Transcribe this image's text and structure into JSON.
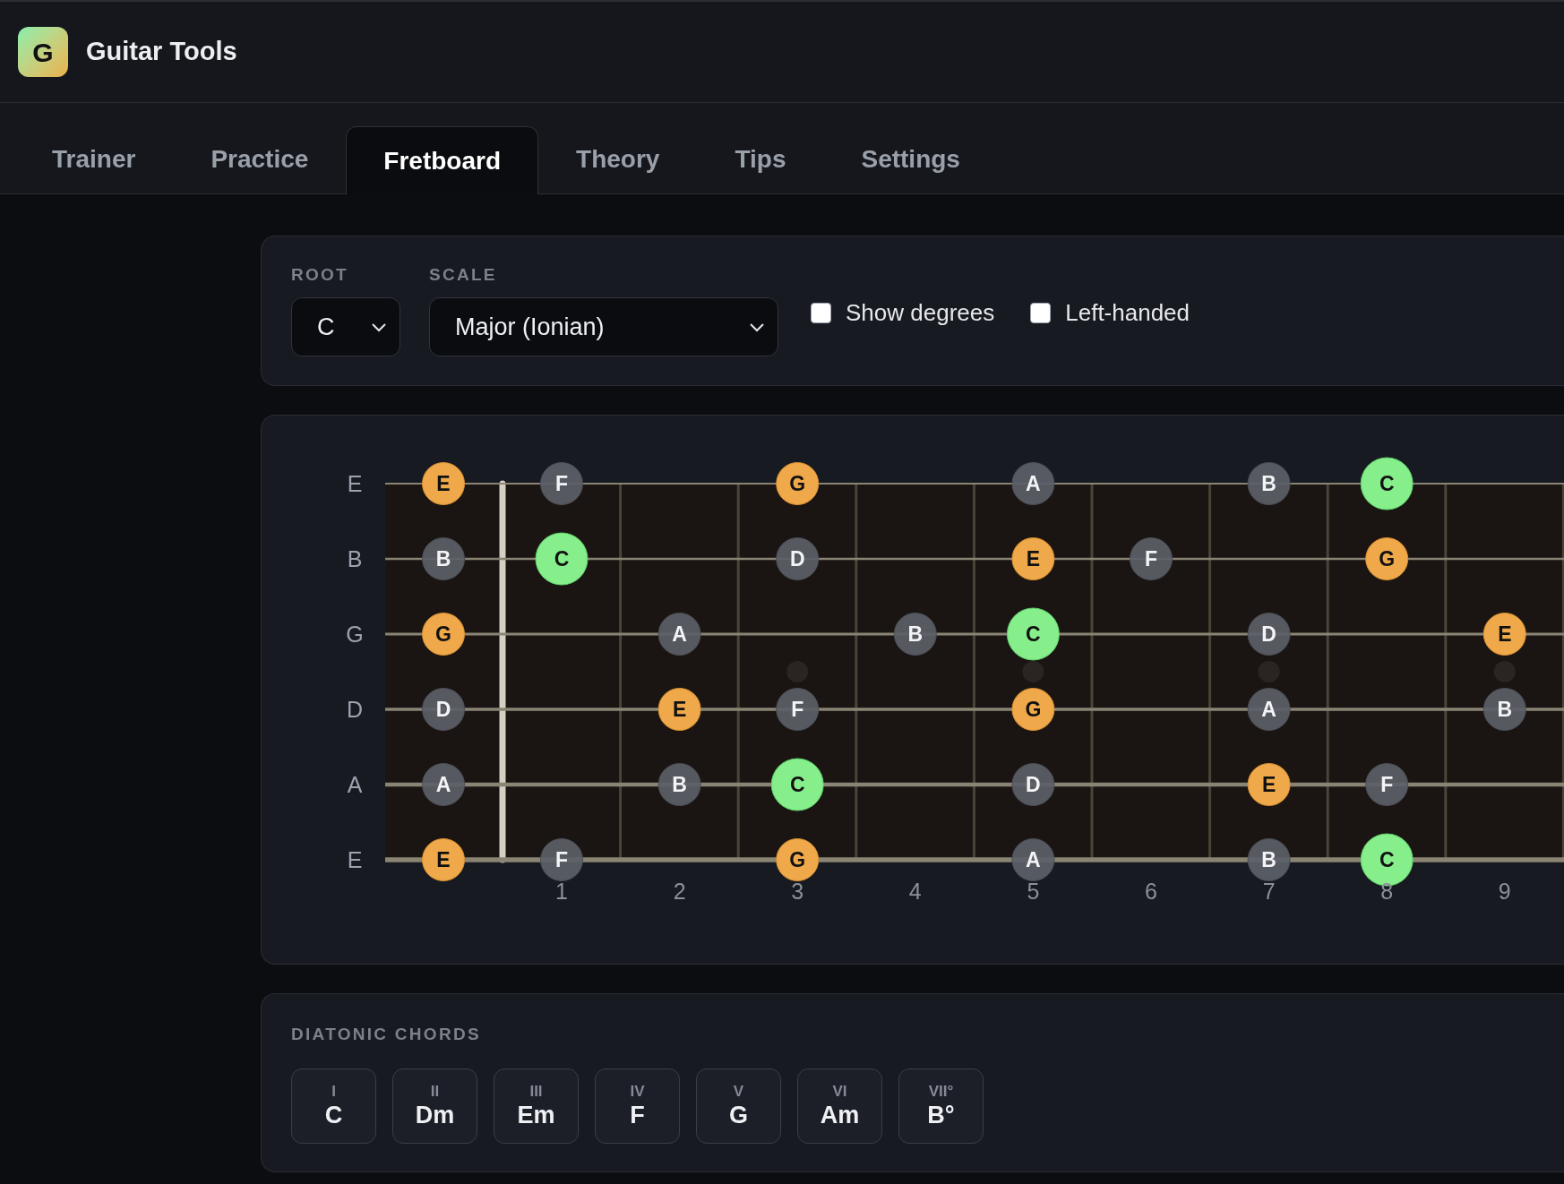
{
  "app": {
    "logo": "G",
    "title": "Guitar Tools"
  },
  "tabs": [
    {
      "label": "Trainer",
      "selected": false
    },
    {
      "label": "Practice",
      "selected": false
    },
    {
      "label": "Fretboard",
      "selected": true
    },
    {
      "label": "Theory",
      "selected": false
    },
    {
      "label": "Tips",
      "selected": false
    },
    {
      "label": "Settings",
      "selected": false
    }
  ],
  "controls": {
    "root": {
      "label": "ROOT",
      "value": "C"
    },
    "scale": {
      "label": "SCALE",
      "value": "Major (Ionian)"
    },
    "options": [
      {
        "label": "Show degrees",
        "checked": false
      },
      {
        "label": "Left-handed",
        "checked": false
      }
    ]
  },
  "fretboard": {
    "strings": [
      {
        "label": "E",
        "cells": [
          {
            "kind": "chord_tone",
            "note": "E"
          },
          {
            "kind": "scale",
            "note": "F"
          },
          {
            "kind": "empty"
          },
          {
            "kind": "chord_tone",
            "note": "G"
          },
          {
            "kind": "empty"
          },
          {
            "kind": "scale",
            "note": "A"
          },
          {
            "kind": "empty"
          },
          {
            "kind": "scale",
            "note": "B"
          },
          {
            "kind": "root",
            "note": "C"
          },
          {
            "kind": "empty"
          }
        ]
      },
      {
        "label": "B",
        "cells": [
          {
            "kind": "scale",
            "note": "B"
          },
          {
            "kind": "root",
            "note": "C"
          },
          {
            "kind": "empty"
          },
          {
            "kind": "scale",
            "note": "D"
          },
          {
            "kind": "empty"
          },
          {
            "kind": "chord_tone",
            "note": "E"
          },
          {
            "kind": "scale",
            "note": "F"
          },
          {
            "kind": "empty"
          },
          {
            "kind": "chord_tone",
            "note": "G"
          },
          {
            "kind": "empty"
          }
        ]
      },
      {
        "label": "G",
        "cells": [
          {
            "kind": "chord_tone",
            "note": "G"
          },
          {
            "kind": "empty"
          },
          {
            "kind": "scale",
            "note": "A"
          },
          {
            "kind": "empty"
          },
          {
            "kind": "scale",
            "note": "B"
          },
          {
            "kind": "root",
            "note": "C"
          },
          {
            "kind": "empty"
          },
          {
            "kind": "scale",
            "note": "D"
          },
          {
            "kind": "empty"
          },
          {
            "kind": "chord_tone",
            "note": "E"
          }
        ]
      },
      {
        "label": "D",
        "cells": [
          {
            "kind": "scale",
            "note": "D"
          },
          {
            "kind": "empty"
          },
          {
            "kind": "chord_tone",
            "note": "E"
          },
          {
            "kind": "scale",
            "note": "F"
          },
          {
            "kind": "empty"
          },
          {
            "kind": "chord_tone",
            "note": "G"
          },
          {
            "kind": "empty"
          },
          {
            "kind": "scale",
            "note": "A"
          },
          {
            "kind": "empty"
          },
          {
            "kind": "scale",
            "note": "B"
          }
        ]
      },
      {
        "label": "A",
        "cells": [
          {
            "kind": "scale",
            "note": "A"
          },
          {
            "kind": "empty"
          },
          {
            "kind": "scale",
            "note": "B"
          },
          {
            "kind": "root",
            "note": "C"
          },
          {
            "kind": "empty"
          },
          {
            "kind": "scale",
            "note": "D"
          },
          {
            "kind": "empty"
          },
          {
            "kind": "chord_tone",
            "note": "E"
          },
          {
            "kind": "scale",
            "note": "F"
          },
          {
            "kind": "empty"
          }
        ]
      },
      {
        "label": "E",
        "cells": [
          {
            "kind": "chord_tone",
            "note": "E"
          },
          {
            "kind": "scale",
            "note": "F"
          },
          {
            "kind": "empty"
          },
          {
            "kind": "chord_tone",
            "note": "G"
          },
          {
            "kind": "empty"
          },
          {
            "kind": "scale",
            "note": "A"
          },
          {
            "kind": "empty"
          },
          {
            "kind": "scale",
            "note": "B"
          },
          {
            "kind": "root",
            "note": "C"
          },
          {
            "kind": "empty"
          }
        ]
      }
    ],
    "frets": [
      {
        "label": "1",
        "inlay": false
      },
      {
        "label": "2",
        "inlay": false
      },
      {
        "label": "3",
        "inlay": true
      },
      {
        "label": "4",
        "inlay": false
      },
      {
        "label": "5",
        "inlay": true
      },
      {
        "label": "6",
        "inlay": false
      },
      {
        "label": "7",
        "inlay": true
      },
      {
        "label": "8",
        "inlay": false
      },
      {
        "label": "9",
        "inlay": true
      }
    ]
  },
  "chords": {
    "title": "DIATONIC CHORDS",
    "items": [
      {
        "degree": "I",
        "name": "C"
      },
      {
        "degree": "II",
        "name": "Dm"
      },
      {
        "degree": "III",
        "name": "Em"
      },
      {
        "degree": "IV",
        "name": "F"
      },
      {
        "degree": "V",
        "name": "G"
      },
      {
        "degree": "VI",
        "name": "Am"
      },
      {
        "degree": "VII°",
        "name": "B°"
      }
    ]
  }
}
